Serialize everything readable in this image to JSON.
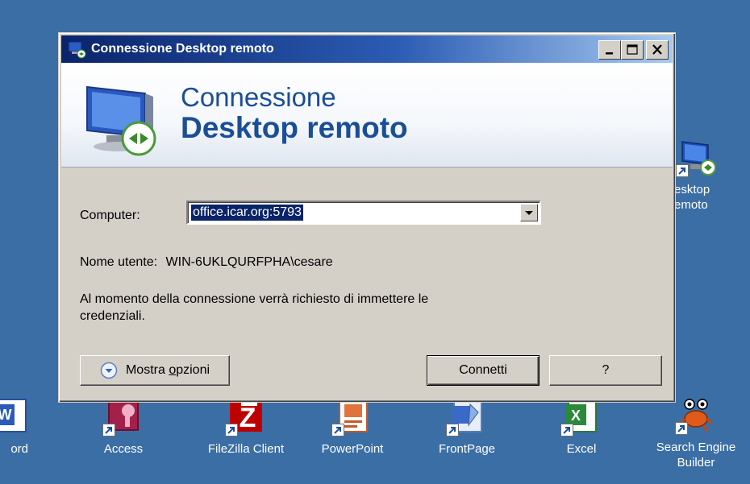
{
  "dialog": {
    "title": "Connessione Desktop remoto",
    "banner_line1": "Connessione",
    "banner_line2": "Desktop remoto",
    "computer_label": "Computer:",
    "computer_value": "office.icar.org:5793",
    "username_label": "Nome utente:",
    "username_value": "WIN-6UKLQURFPHA\\cesare",
    "info_line1": "Al momento della connessione verrà richiesto di immettere le",
    "info_line2": "credenziali.",
    "options_label_pre": "Mostra ",
    "options_label_accel": "o",
    "options_label_post": "pzioni",
    "connect_label": "Connetti",
    "help_label": "?"
  },
  "desktop": {
    "icons": [
      {
        "label": "ord",
        "icon": "word-icon"
      },
      {
        "label": "Access",
        "icon": "access-icon"
      },
      {
        "label": "FileZilla Client",
        "icon": "filezilla-icon"
      },
      {
        "label": "PowerPoint",
        "icon": "powerpoint-icon"
      },
      {
        "label": "FrontPage",
        "icon": "frontpage-icon"
      },
      {
        "label": "Excel",
        "icon": "excel-icon"
      },
      {
        "label_line1": "Search Engine",
        "label_line2": "Builder",
        "icon": "search-engine-builder-icon"
      },
      {
        "label_line1": "esktop",
        "label_line2": "emoto",
        "icon": "remote-desktop-icon"
      }
    ]
  },
  "colors": {
    "desktop_bg": "#3a6ea5",
    "titlebar_start": "#0a246a",
    "titlebar_end": "#a6caf0",
    "banner_text": "#1a4e96",
    "dialog_bg": "#d4d0c8"
  }
}
